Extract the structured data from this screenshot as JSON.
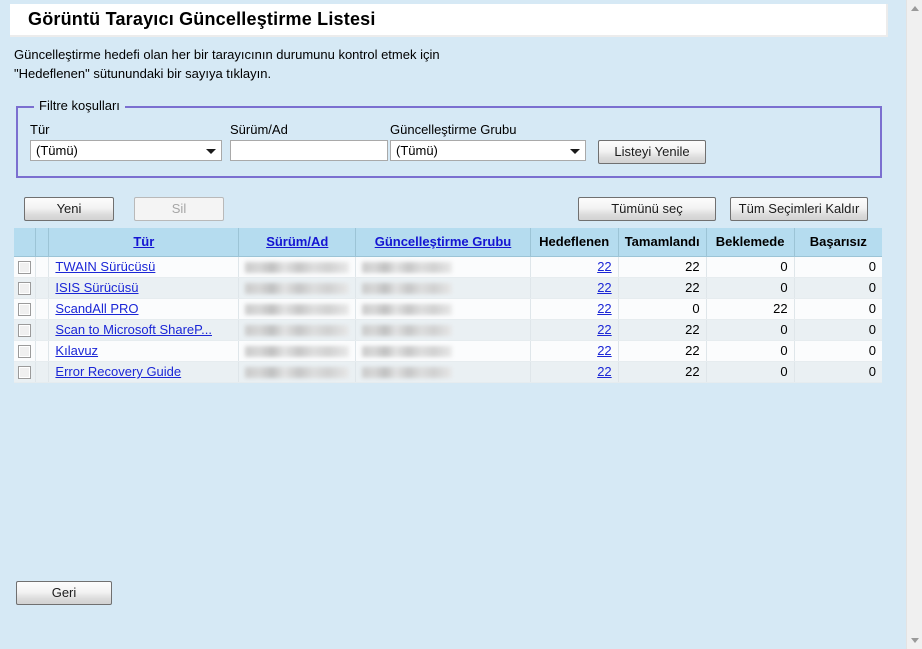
{
  "page": {
    "title": "Görüntü Tarayıcı Güncelleştirme Listesi",
    "description_line1": "Güncelleştirme hedefi olan her bir tarayıcının durumunu kontrol etmek için",
    "description_line2": "\"Hedeflenen\" sütunundaki bir sayıya tıklayın.",
    "background_color": "#d6e9f5"
  },
  "filter": {
    "legend": "Filtre koşulları",
    "border_color": "#7b6fd0",
    "type": {
      "label": "Tür",
      "value": "(Tümü)",
      "options": [
        "(Tümü)"
      ]
    },
    "version_name": {
      "label": "Sürüm/Ad",
      "value": "",
      "placeholder": ""
    },
    "update_group": {
      "label": "Güncelleştirme Grubu",
      "value": "(Tümü)",
      "options": [
        "(Tümü)"
      ]
    },
    "refresh_button": "Listeyi Yenile"
  },
  "actions": {
    "new": "Yeni",
    "delete": "Sil",
    "delete_disabled": true,
    "select_all": "Tümünü seç",
    "deselect_all": "Tüm Seçimleri Kaldır"
  },
  "table": {
    "headers": {
      "checkbox": "",
      "blank": "",
      "type": "Tür",
      "version_name": "Sürüm/Ad",
      "update_group": "Güncelleştirme Grubu",
      "targeted": "Hedeflenen",
      "completed": "Tamamlandı",
      "pending": "Beklemede",
      "failed": "Başarısız"
    },
    "header_bg": "#b5dcef",
    "link_color": "#1b26d6",
    "rows": [
      {
        "checked": false,
        "type": "TWAIN Sürücüsü",
        "version_name": "",
        "update_group": "",
        "targeted": "22",
        "completed": "22",
        "pending": "0",
        "failed": "0"
      },
      {
        "checked": false,
        "type": "ISIS Sürücüsü",
        "version_name": "",
        "update_group": "",
        "targeted": "22",
        "completed": "22",
        "pending": "0",
        "failed": "0"
      },
      {
        "checked": false,
        "type": "ScandAll PRO",
        "version_name": "",
        "update_group": "",
        "targeted": "22",
        "completed": "0",
        "pending": "22",
        "failed": "0"
      },
      {
        "checked": false,
        "type": "Scan to Microsoft ShareP...",
        "version_name": "",
        "update_group": "",
        "targeted": "22",
        "completed": "22",
        "pending": "0",
        "failed": "0"
      },
      {
        "checked": false,
        "type": "Kılavuz",
        "version_name": "",
        "update_group": "",
        "targeted": "22",
        "completed": "22",
        "pending": "0",
        "failed": "0"
      },
      {
        "checked": false,
        "type": "Error Recovery Guide",
        "version_name": "",
        "update_group": "",
        "targeted": "22",
        "completed": "22",
        "pending": "0",
        "failed": "0"
      }
    ]
  },
  "footer": {
    "back": "Geri"
  },
  "scrollbar": {
    "up_icon": "triangle-up-icon",
    "down_icon": "triangle-down-icon"
  }
}
